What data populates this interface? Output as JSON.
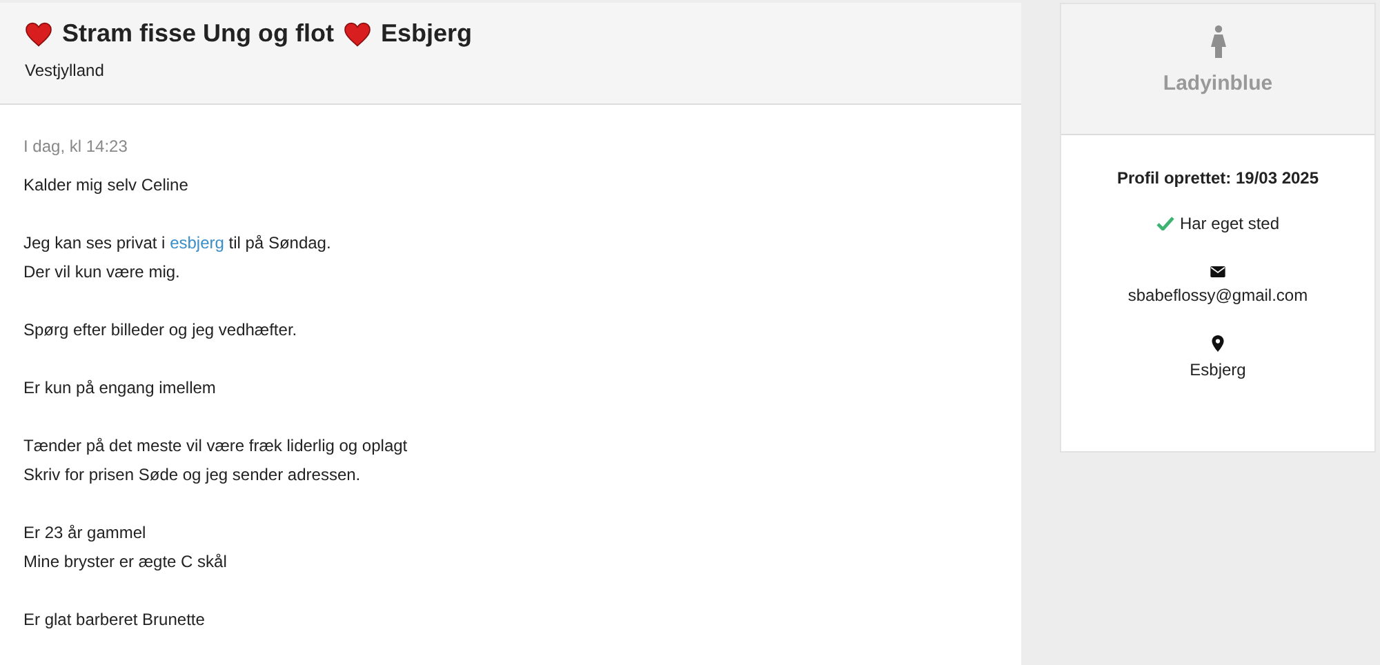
{
  "post": {
    "title_parts": [
      {
        "kind": "heart"
      },
      {
        "kind": "text",
        "text": "Stram fisse Ung og flot"
      },
      {
        "kind": "heart"
      },
      {
        "kind": "text",
        "text": "Esbjerg"
      }
    ],
    "region": "Vestjylland",
    "date": "I dag, kl 14:23",
    "paragraphs": [
      [
        [
          {
            "kind": "text",
            "text": "Kalder mig selv Celine"
          }
        ]
      ],
      [
        [
          {
            "kind": "text",
            "text": "Jeg kan ses privat i "
          },
          {
            "kind": "link",
            "text": "esbjerg"
          },
          {
            "kind": "text",
            "text": " til på Søndag."
          }
        ],
        [
          {
            "kind": "text",
            "text": "Der vil kun være mig."
          }
        ]
      ],
      [
        [
          {
            "kind": "text",
            "text": "Spørg efter billeder og jeg vedhæfter."
          }
        ]
      ],
      [
        [
          {
            "kind": "text",
            "text": "Er kun på engang imellem"
          }
        ]
      ],
      [
        [
          {
            "kind": "text",
            "text": "Tænder på det meste vil være fræk liderlig og oplagt"
          }
        ],
        [
          {
            "kind": "text",
            "text": "Skriv for prisen Søde og jeg sender adressen."
          }
        ]
      ],
      [
        [
          {
            "kind": "text",
            "text": "Er 23 år gammel"
          }
        ],
        [
          {
            "kind": "text",
            "text": "Mine bryster er ægte C skål"
          }
        ]
      ],
      [
        [
          {
            "kind": "text",
            "text": "Er glat barberet Brunette"
          }
        ]
      ]
    ]
  },
  "profile": {
    "username": "Ladyinblue",
    "created": "Profil oprettet: 19/03 2025",
    "items": [
      {
        "kind": "check",
        "text": "Har eget sted"
      },
      {
        "kind": "email",
        "text": "sbabeflossy@gmail.com"
      },
      {
        "kind": "location",
        "text": "Esbjerg"
      }
    ]
  }
}
